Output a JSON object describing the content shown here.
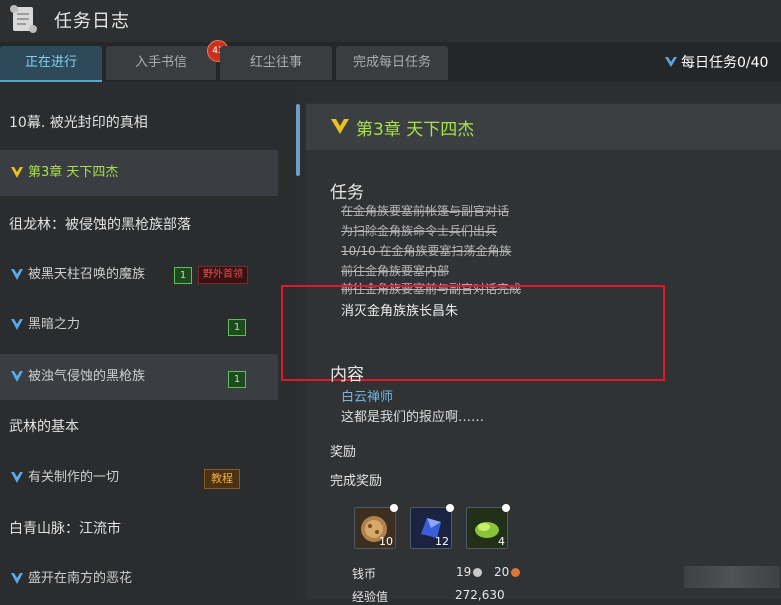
{
  "window": {
    "title": "任务日志"
  },
  "tabs": [
    {
      "label": "正在进行"
    },
    {
      "label": "入手书信"
    },
    {
      "label": "红尘往事"
    },
    {
      "label": "完成每日任务"
    }
  ],
  "letters_badge": "43",
  "daily": {
    "label": "每日任务0/40"
  },
  "quest_list": [
    {
      "label": "10幕. 被光封印的真相"
    },
    {
      "label": "第3章 天下四杰"
    },
    {
      "label": "徂龙林：被侵蚀的黑枪族部落"
    },
    {
      "label": "被黑天柱召唤的魔族",
      "count": "1",
      "tag": "野外首领"
    },
    {
      "label": "黑暗之力",
      "count": "1"
    },
    {
      "label": "被浊气侵蚀的黑枪族",
      "count": "1"
    },
    {
      "label": "武林的基本"
    },
    {
      "label": "有关制作的一切",
      "tag": "教程"
    },
    {
      "label": "白青山脉：江流市"
    },
    {
      "label": "盛开在南方的恶花"
    }
  ],
  "detail": {
    "chapter_title": "第3章 天下四杰",
    "task_heading": "任务",
    "completed_tasks": [
      "在金角族要塞前帐篷与副官对话",
      "为扫除金角族命令士兵们出兵",
      "10/10 在金角族要塞扫荡金角族",
      "前往金角族要塞内部",
      "前往金角族要塞前与副官对话完成"
    ],
    "current_task": "消灭金角族族长昌朱",
    "content_heading": "内容",
    "npc_name": "白云禅师",
    "speech": "这都是我们的报应啊……",
    "reward_heading": "奖励",
    "completion_reward_heading": "完成奖励",
    "reward_items": [
      {
        "icon": "food-item-icon",
        "count": "10"
      },
      {
        "icon": "gem-item-icon",
        "count": "12"
      },
      {
        "icon": "herb-item-icon",
        "count": "4"
      }
    ],
    "money_label": "钱币",
    "money_silver": "19",
    "money_copper": "20",
    "exp_label": "经验值",
    "exp_value": "272,630"
  },
  "colors": {
    "accent_green": "#a8e04a",
    "accent_blue": "#6db7e6",
    "highlight_red": "#e0192a"
  }
}
